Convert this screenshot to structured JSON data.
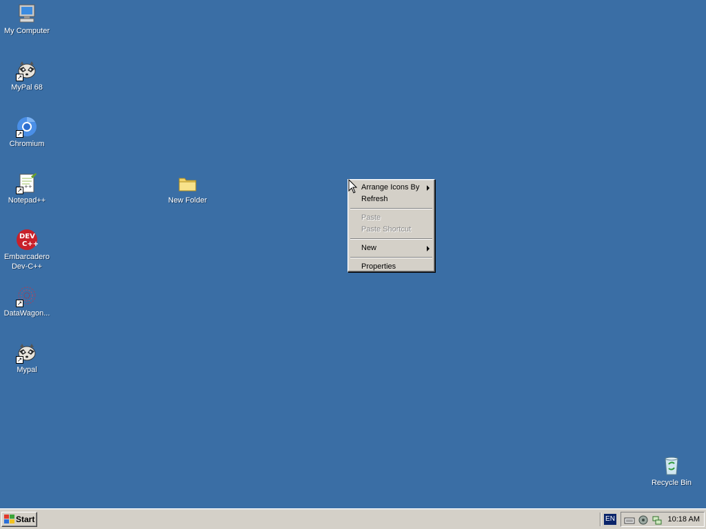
{
  "desktop": {
    "icons": [
      {
        "label": "My Computer",
        "icon": "my-computer-icon"
      },
      {
        "label": "MyPal 68",
        "icon": "raccoon-browser-icon"
      },
      {
        "label": "Chromium",
        "icon": "chromium-icon"
      },
      {
        "label": "Notepad++",
        "icon": "notepad-plus-plus-icon"
      },
      {
        "label": "Embarcadero\nDev-C++",
        "icon": "dev-cpp-icon"
      },
      {
        "label": "DataWagon...",
        "icon": "datawagon-icon"
      },
      {
        "label": "Mypal",
        "icon": "raccoon-browser-icon"
      },
      {
        "label": "New Folder",
        "icon": "folder-icon"
      },
      {
        "label": "Recycle Bin",
        "icon": "recycle-bin-icon"
      }
    ]
  },
  "context_menu": {
    "items": [
      {
        "label": "Arrange Icons By",
        "submenu": true,
        "enabled": true
      },
      {
        "label": "Refresh",
        "submenu": false,
        "enabled": true
      },
      {
        "label": "Paste",
        "submenu": false,
        "enabled": false
      },
      {
        "label": "Paste Shortcut",
        "submenu": false,
        "enabled": false
      },
      {
        "label": "New",
        "submenu": true,
        "enabled": true
      },
      {
        "label": "Properties",
        "submenu": false,
        "enabled": true
      }
    ]
  },
  "taskbar": {
    "start_label": "Start",
    "language": "EN",
    "clock": "10:18 AM"
  },
  "colors": {
    "desktop_background": "#3a6ea5",
    "taskbar": "#d4d0c8",
    "menu": "#d4d0c8",
    "disabled_text": "#8a8a8a"
  }
}
